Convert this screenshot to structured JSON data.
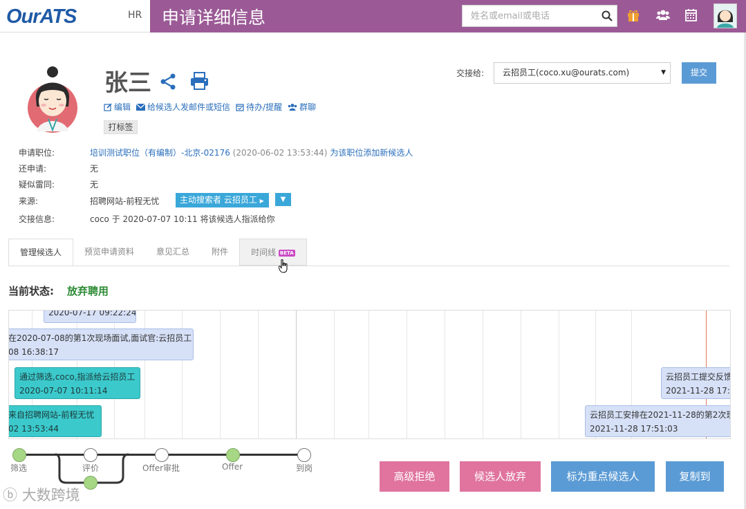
{
  "header": {
    "logo": "OurATS",
    "role": "HR",
    "title": "申请详细信息",
    "search_placeholder": "姓名或email或电话"
  },
  "candidate": {
    "name": "张三",
    "actions": [
      "编辑",
      "给候选人发邮件或短信",
      "待办/提醒",
      "群聊"
    ],
    "tag_button": "打标签"
  },
  "handover": {
    "label": "交接给:",
    "selected": "云招员工(coco.xu@ourats.com)",
    "submit": "提交"
  },
  "info": {
    "position_label": "申请职位:",
    "position_value": "培训测试职位（有编制）-北京-02176",
    "position_date": "(2020-06-02 13:53:44)",
    "add_candidate_link": "为该职位添加新候选人",
    "also_applied_label": "还申请:",
    "also_applied_value": "无",
    "duplicate_label": "疑似雷同:",
    "duplicate_value": "无",
    "source_label": "来源:",
    "source_value": "招聘网站-前程无忧",
    "source_button": "主动搜索者 云招员工",
    "handover_info_label": "交接信息:",
    "handover_info_value": "coco 于 2020-07-07 10:11 将该候选人指派给你"
  },
  "tabs": [
    "管理候选人",
    "预览申请资料",
    "意见汇总",
    "附件",
    "时间线"
  ],
  "beta_badge": "BETA",
  "status": {
    "label": "当前状态:",
    "value": "放弃聘用"
  },
  "timeline": {
    "events": [
      {
        "line1": "2020-07-17 09:22:24",
        "line2": ""
      },
      {
        "line1": "在2020-07-08的第1次现场面试,面试官:云招员工",
        "line2": "08 16:38:17"
      },
      {
        "line1": "通过筛选,coco,指派给云招员工",
        "line2": "2020-07-07 10:11:14"
      },
      {
        "line1": "来自招聘网站-前程无忧",
        "line2": "02 13:53:44"
      },
      {
        "line1": "云招员工提交反馈",
        "line2": "2021-11-28 17:5"
      },
      {
        "line1": "云招员工安排在2021-11-28的第2次现",
        "line2": "2021-11-28 17:51:03"
      }
    ]
  },
  "stages": [
    "筛选",
    "评价",
    "Offer审批",
    "Offer",
    "到岗"
  ],
  "action_buttons": [
    "高级拒绝",
    "候选人放弃",
    "标为重点候选人",
    "复制到"
  ],
  "watermark": "大数跨境"
}
